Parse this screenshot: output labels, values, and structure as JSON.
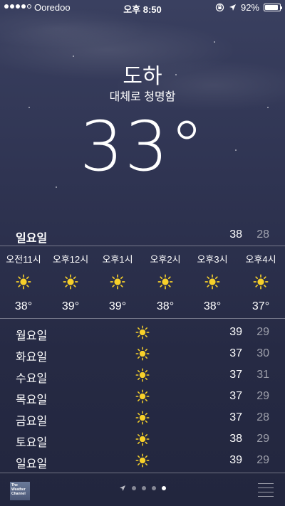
{
  "status_bar": {
    "carrier": "Ooredoo",
    "time": "오후 8:50",
    "battery": "92%",
    "battery_level": 0.92,
    "signal_bars": 4,
    "signal_max": 5
  },
  "weather": {
    "city": "도하",
    "condition": "대체로 청명함",
    "temperature": "33°"
  },
  "today": {
    "day": "일요일",
    "high": "38",
    "low": "28"
  },
  "hourly": [
    {
      "time": "오전11시",
      "icon": "sun-icon",
      "temp": "38°"
    },
    {
      "time": "오후12시",
      "icon": "sun-icon",
      "temp": "39°"
    },
    {
      "time": "오후1시",
      "icon": "sun-icon",
      "temp": "39°"
    },
    {
      "time": "오후2시",
      "icon": "sun-icon",
      "temp": "38°"
    },
    {
      "time": "오후3시",
      "icon": "sun-icon",
      "temp": "38°"
    },
    {
      "time": "오후4시",
      "icon": "sun-icon",
      "temp": "37°"
    }
  ],
  "daily": [
    {
      "day": "월요일",
      "icon": "sun-icon",
      "high": "39",
      "low": "29"
    },
    {
      "day": "화요일",
      "icon": "sun-icon",
      "high": "37",
      "low": "30"
    },
    {
      "day": "수요일",
      "icon": "sun-icon",
      "high": "37",
      "low": "31"
    },
    {
      "day": "목요일",
      "icon": "sun-icon",
      "high": "37",
      "low": "29"
    },
    {
      "day": "금요일",
      "icon": "sun-icon",
      "high": "37",
      "low": "28"
    },
    {
      "day": "토요일",
      "icon": "sun-icon",
      "high": "38",
      "low": "29"
    },
    {
      "day": "일요일",
      "icon": "sun-icon",
      "high": "39",
      "low": "29"
    }
  ],
  "bottom_bar": {
    "logo_text": "The Weather Channel",
    "page_count": 4,
    "active_page": 4
  },
  "colors": {
    "sun": "#f7d02a",
    "background_top": "#3a4060",
    "background_bottom": "#22263e"
  }
}
